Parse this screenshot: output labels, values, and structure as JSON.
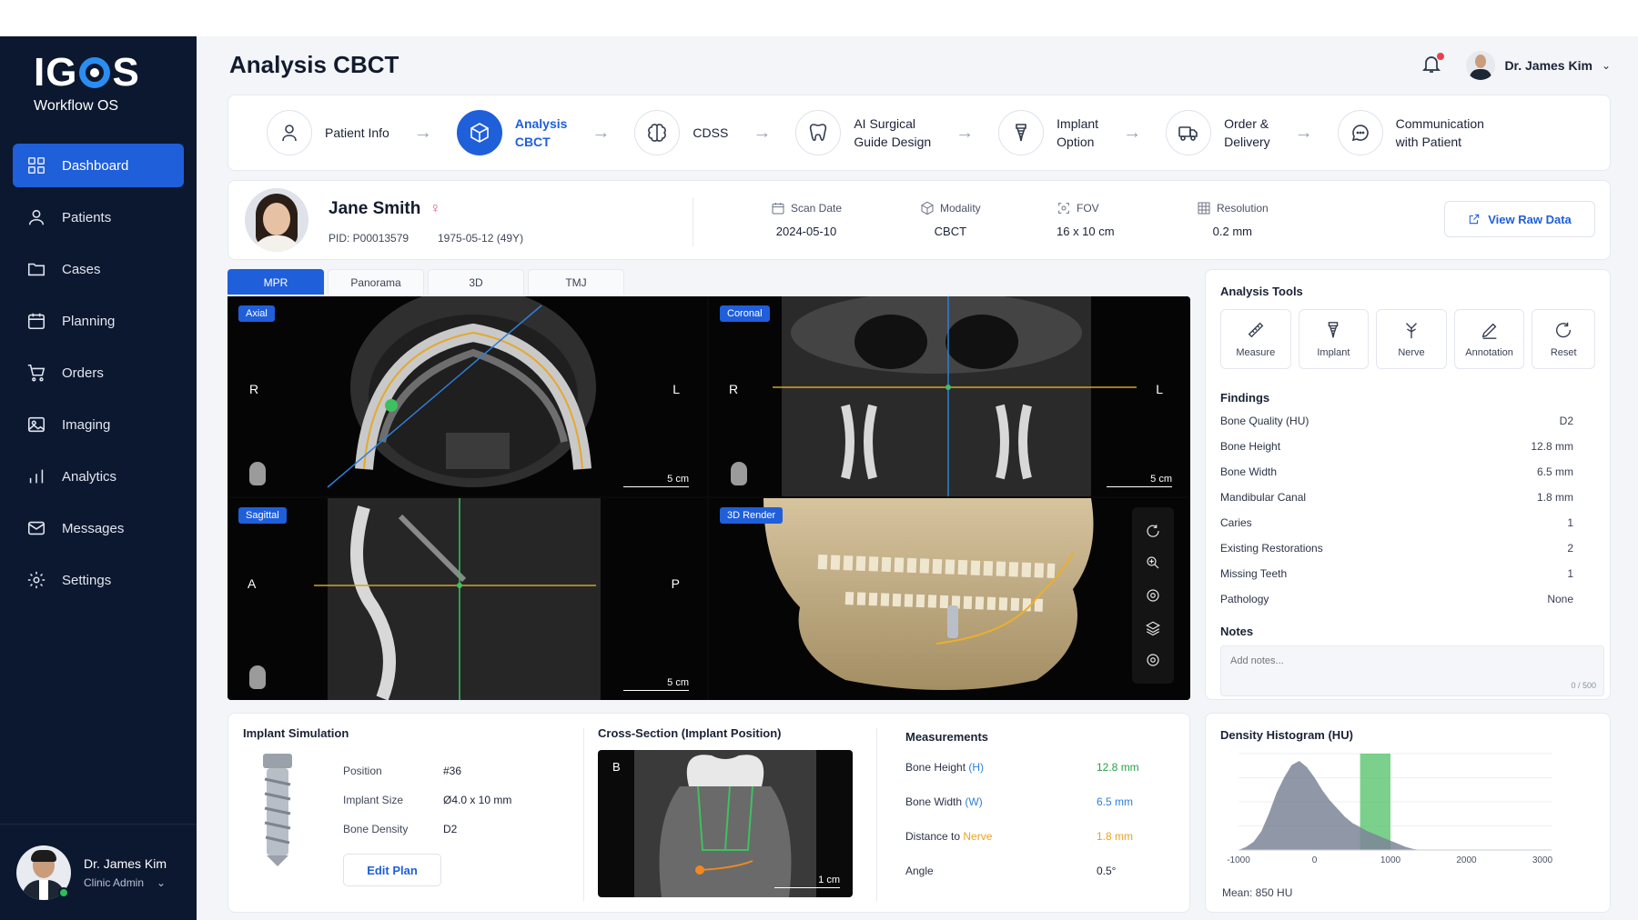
{
  "brand": {
    "logo": "IGOS",
    "logo_pre": "IG",
    "logo_post": "S",
    "subtitle": "Workflow OS"
  },
  "sidebar": {
    "items": [
      {
        "label": "Dashboard",
        "icon": "grid-icon",
        "active": true
      },
      {
        "label": "Patients",
        "icon": "user-icon"
      },
      {
        "label": "Cases",
        "icon": "folder-icon"
      },
      {
        "label": "Planning",
        "icon": "calendar-icon"
      },
      {
        "label": "Orders",
        "icon": "cart-icon"
      },
      {
        "label": "Imaging",
        "icon": "image-icon"
      },
      {
        "label": "Analytics",
        "icon": "bar-chart-icon"
      },
      {
        "label": "Messages",
        "icon": "mail-icon"
      },
      {
        "label": "Settings",
        "icon": "gear-icon"
      }
    ],
    "user": {
      "name": "Dr. James Kim",
      "role": "Clinic Admin"
    }
  },
  "header": {
    "title": "Analysis CBCT",
    "user_name": "Dr. James Kim"
  },
  "workflow": {
    "steps": [
      {
        "label": "Patient Info",
        "icon": "person-icon"
      },
      {
        "label": "Analysis\nCBCT",
        "icon": "cube-icon",
        "active": true
      },
      {
        "label": "CDSS",
        "icon": "brain-icon"
      },
      {
        "label": "AI Surgical\nGuide Design",
        "icon": "tooth-icon"
      },
      {
        "label": "Implant\nOption",
        "icon": "implant-icon"
      },
      {
        "label": "Order &\nDelivery",
        "icon": "truck-icon"
      },
      {
        "label": "Communication\nwith Patient",
        "icon": "chat-icon"
      }
    ]
  },
  "patient": {
    "name": "Jane Smith",
    "gender_symbol": "♀",
    "pid": "PID: P00013579",
    "dob": "1975-05-12 (49Y)",
    "meta": [
      {
        "label": "Scan Date",
        "value": "2024-05-10",
        "icon": "calendar-icon"
      },
      {
        "label": "Modality",
        "value": "CBCT",
        "icon": "cube-icon"
      },
      {
        "label": "FOV",
        "value": "16 x 10 cm",
        "icon": "focus-icon"
      },
      {
        "label": "Resolution",
        "value": "0.2 mm",
        "icon": "grid-icon"
      }
    ],
    "raw_button": "View Raw Data"
  },
  "viewer": {
    "tabs": [
      "MPR",
      "Panorama",
      "3D",
      "TMJ"
    ],
    "active_tab": "MPR",
    "panes": {
      "axial": {
        "tag": "Axial",
        "left": "R",
        "right": "L",
        "scale": "5 cm"
      },
      "coronal": {
        "tag": "Coronal",
        "left": "R",
        "right": "L",
        "scale": "5 cm"
      },
      "sagittal": {
        "tag": "Sagittal",
        "left": "A",
        "right": "P",
        "scale": "5 cm"
      },
      "render": {
        "tag": "3D Render"
      }
    }
  },
  "analysis": {
    "title": "Analysis Tools",
    "tools": [
      {
        "label": "Measure",
        "icon": "ruler-icon"
      },
      {
        "label": "Implant",
        "icon": "implant-icon"
      },
      {
        "label": "Nerve",
        "icon": "nerve-icon"
      },
      {
        "label": "Annotation",
        "icon": "pen-icon"
      },
      {
        "label": "Reset",
        "icon": "reset-icon"
      }
    ],
    "findings_title": "Findings",
    "findings": [
      {
        "label": "Bone Quality (HU)",
        "value": "D2"
      },
      {
        "label": "Bone Height",
        "value": "12.8 mm"
      },
      {
        "label": "Bone Width",
        "value": "6.5 mm"
      },
      {
        "label": "Mandibular Canal",
        "value": "1.8 mm"
      },
      {
        "label": "Caries",
        "value": "1"
      },
      {
        "label": "Existing Restorations",
        "value": "2"
      },
      {
        "label": "Missing Teeth",
        "value": "1"
      },
      {
        "label": "Pathology",
        "value": "None"
      }
    ],
    "notes_title": "Notes",
    "notes_placeholder": "Add notes...",
    "notes_count": "0 / 500"
  },
  "simulation": {
    "title": "Implant Simulation",
    "rows": [
      {
        "label": "Position",
        "value": "#36"
      },
      {
        "label": "Implant Size",
        "value": "Ø4.0 x 10 mm"
      },
      {
        "label": "Bone Density",
        "value": "D2"
      }
    ],
    "edit_button": "Edit Plan"
  },
  "cross_section": {
    "title": "Cross-Section (Implant Position)",
    "tag": "B",
    "scale": "1 cm"
  },
  "measurements": {
    "title": "Measurements",
    "rows": [
      {
        "pre": "Bone Height ",
        "key": "(H)",
        "post": "",
        "value": "12.8 mm",
        "color": "#2aa04a"
      },
      {
        "pre": "Bone Width ",
        "key": "(W)",
        "post": "",
        "value": "6.5 mm",
        "color": "#2f7fd8"
      },
      {
        "pre": "Distance to ",
        "key": "Nerve",
        "post": "",
        "value": "1.8 mm",
        "color": "#f0a020"
      },
      {
        "pre": "Angle",
        "key": "",
        "post": "",
        "value": "0.5°",
        "color": "#1a2236"
      }
    ]
  },
  "histogram": {
    "title": "Density Histogram (HU)",
    "mean": "Mean: 850 HU",
    "chart_data": {
      "type": "area",
      "x": [
        -1000,
        -900,
        -800,
        -700,
        -600,
        -500,
        -400,
        -300,
        -200,
        -100,
        0,
        100,
        200,
        300,
        400,
        500,
        600,
        700,
        800,
        900,
        1000,
        1100,
        1200,
        1300,
        1400
      ],
      "values": [
        0,
        3,
        8,
        18,
        35,
        55,
        70,
        82,
        86,
        80,
        70,
        58,
        48,
        40,
        32,
        26,
        22,
        18,
        15,
        12,
        9,
        6,
        3,
        1,
        0
      ],
      "ticks": [
        "-1000",
        "0",
        "1000",
        "2000",
        "3000"
      ],
      "xlim": [
        -1000,
        3000
      ],
      "highlight": [
        600,
        1000
      ],
      "highlight_color": "#4fc065",
      "fill_color": "#7d8596"
    }
  }
}
